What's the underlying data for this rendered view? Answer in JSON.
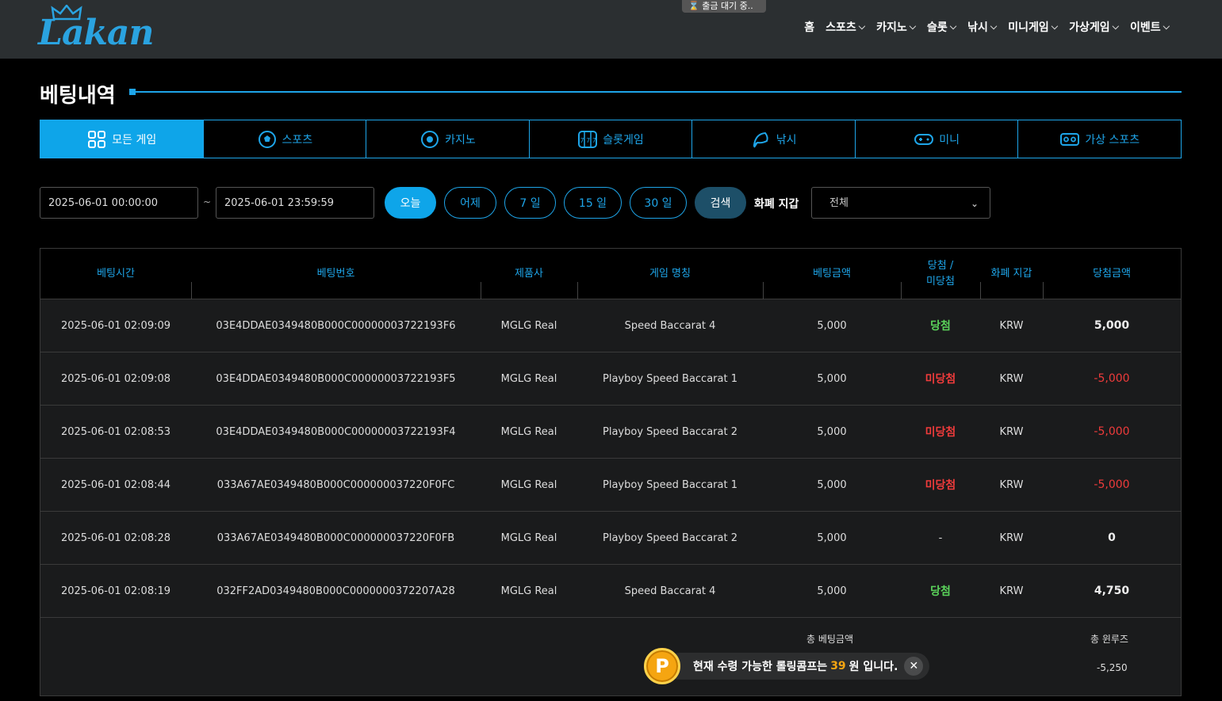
{
  "header": {
    "logo_text": "Lakan",
    "pending_badge": "출금 대기 중..",
    "nav": [
      {
        "label": "홈",
        "chevron": false
      },
      {
        "label": "스포츠",
        "chevron": true
      },
      {
        "label": "카지노",
        "chevron": true
      },
      {
        "label": "슬롯",
        "chevron": true
      },
      {
        "label": "낚시",
        "chevron": true
      },
      {
        "label": "미니게임",
        "chevron": true
      },
      {
        "label": "가상게임",
        "chevron": true
      },
      {
        "label": "이벤트",
        "chevron": true
      }
    ]
  },
  "page": {
    "title": "베팅내역"
  },
  "tabs": [
    {
      "label": "모든 게임",
      "icon": "grid-icon",
      "active": true
    },
    {
      "label": "스포츠",
      "icon": "soccer-ball-icon",
      "active": false
    },
    {
      "label": "카지노",
      "icon": "casino-chip-icon",
      "active": false
    },
    {
      "label": "슬롯게임",
      "icon": "slot-machine-icon",
      "active": false
    },
    {
      "label": "낚시",
      "icon": "fish-icon",
      "active": false
    },
    {
      "label": "미니",
      "icon": "gamepad-icon",
      "active": false
    },
    {
      "label": "가상 스포츠",
      "icon": "vr-headset-icon",
      "active": false
    }
  ],
  "filter": {
    "start_date": "2025-06-01 00:00:00",
    "separator": "~",
    "end_date": "2025-06-01 23:59:59",
    "quick": [
      "오늘",
      "어제",
      "7 일",
      "15 일",
      "30 일"
    ],
    "search_label": "검색",
    "currency_label": "화폐 지갑",
    "currency_selected": "전체"
  },
  "table": {
    "headers": [
      "베팅시간",
      "베팅번호",
      "제품사",
      "게임 명칭",
      "베팅금액",
      "당첨 /\n미당첨",
      "화폐 지갑",
      "당첨금액"
    ],
    "rows": [
      {
        "time": "2025-06-01 02:09:09",
        "id": "03E4DDAE0349480B000C00000003722193F6",
        "vendor": "MGLG Real",
        "game": "Speed Baccarat 4",
        "bet": "5,000",
        "result": "당첨",
        "result_type": "win",
        "currency": "KRW",
        "payout": "5,000",
        "payout_type": "pos"
      },
      {
        "time": "2025-06-01 02:09:08",
        "id": "03E4DDAE0349480B000C00000003722193F5",
        "vendor": "MGLG Real",
        "game": "Playboy Speed Baccarat 1",
        "bet": "5,000",
        "result": "미당첨",
        "result_type": "lose",
        "currency": "KRW",
        "payout": "-5,000",
        "payout_type": "neg"
      },
      {
        "time": "2025-06-01 02:08:53",
        "id": "03E4DDAE0349480B000C00000003722193F4",
        "vendor": "MGLG Real",
        "game": "Playboy Speed Baccarat 2",
        "bet": "5,000",
        "result": "미당첨",
        "result_type": "lose",
        "currency": "KRW",
        "payout": "-5,000",
        "payout_type": "neg"
      },
      {
        "time": "2025-06-01 02:08:44",
        "id": "033A67AE0349480B000C000000037220F0FC",
        "vendor": "MGLG Real",
        "game": "Playboy Speed Baccarat 1",
        "bet": "5,000",
        "result": "미당첨",
        "result_type": "lose",
        "currency": "KRW",
        "payout": "-5,000",
        "payout_type": "neg"
      },
      {
        "time": "2025-06-01 02:08:28",
        "id": "033A67AE0349480B000C000000037220F0FB",
        "vendor": "MGLG Real",
        "game": "Playboy Speed Baccarat 2",
        "bet": "5,000",
        "result": "-",
        "result_type": "none",
        "currency": "KRW",
        "payout": "0",
        "payout_type": "pos"
      },
      {
        "time": "2025-06-01 02:08:19",
        "id": "032FF2AD0349480B000C0000000372207A28",
        "vendor": "MGLG Real",
        "game": "Speed Baccarat 4",
        "bet": "5,000",
        "result": "당첨",
        "result_type": "win",
        "currency": "KRW",
        "payout": "4,750",
        "payout_type": "pos"
      }
    ],
    "footer": {
      "total_bet_label": "총 베팅금액",
      "total_winloss_label": "총 윈루즈",
      "total_winloss_value": "-5,250"
    }
  },
  "toast": {
    "coin_letter": "P",
    "text_before": "현재 수령 가능한 롤링콤프는",
    "amount": "39",
    "text_after": "원 입니다.",
    "close": "✕"
  },
  "colors": {
    "accent": "#1ea5e9",
    "win": "#5ad35a",
    "lose": "#ef3b3b",
    "coin": "#f5a511"
  }
}
